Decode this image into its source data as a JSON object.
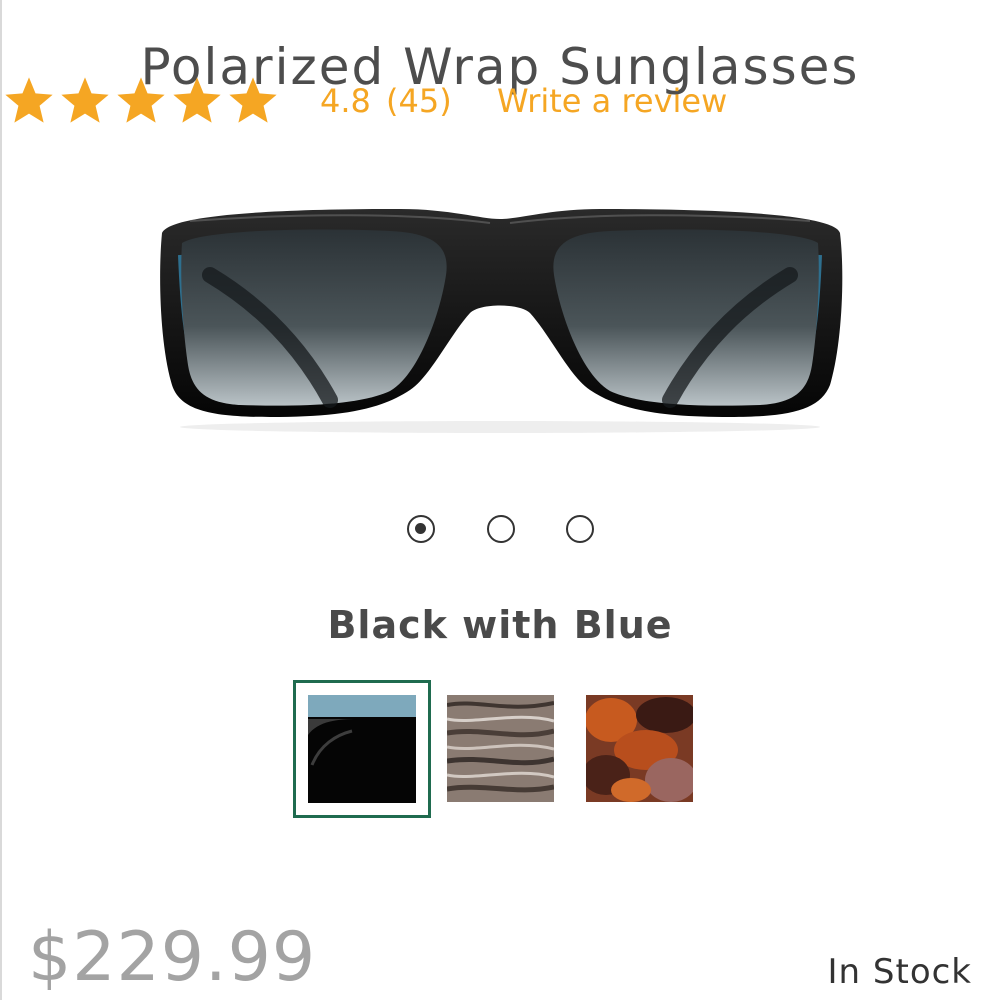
{
  "product": {
    "title": "Polarized Wrap Sunglasses",
    "price": "$229.99",
    "stock_status": "In Stock"
  },
  "rating": {
    "value": "4.8",
    "count": "(45)",
    "stars_filled": 5,
    "stars_total": 5,
    "write_review_label": "Write a review",
    "star_color": "#f5a623"
  },
  "gallery": {
    "current_index": 1,
    "total": 3
  },
  "color": {
    "selected_name": "Black with Blue",
    "selected_border_color": "#1f6b4f",
    "swatches": [
      "black-with-blue",
      "grey-wood-pattern",
      "red-tortoise"
    ]
  }
}
